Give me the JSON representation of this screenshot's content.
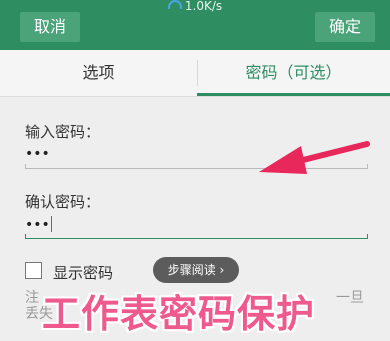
{
  "status": {
    "speed": "1.0K/s"
  },
  "toolbar": {
    "cancel_label": "取消",
    "confirm_label": "确定"
  },
  "tabs": [
    {
      "label": "选项"
    },
    {
      "label": "密码（可选）"
    }
  ],
  "form": {
    "password_label": "输入密码：",
    "password_value": "•••",
    "confirm_label": "确认密码：",
    "confirm_value": "•••",
    "show_password_label": "显示密码",
    "note_line1_left": "注",
    "note_line1_right": "一旦",
    "note_line2": "丢失"
  },
  "overlay": {
    "read_button": "步骤阅读 ›",
    "title": "工作表密码保护"
  },
  "colors": {
    "accent": "#2f8d62",
    "arrow": "#e8275a",
    "overlay_text": "#ee5a8d"
  },
  "icons": {
    "arrow": "red-arrow-icon",
    "checkbox": "checkbox-unchecked-icon",
    "wifi": "wifi-icon"
  }
}
